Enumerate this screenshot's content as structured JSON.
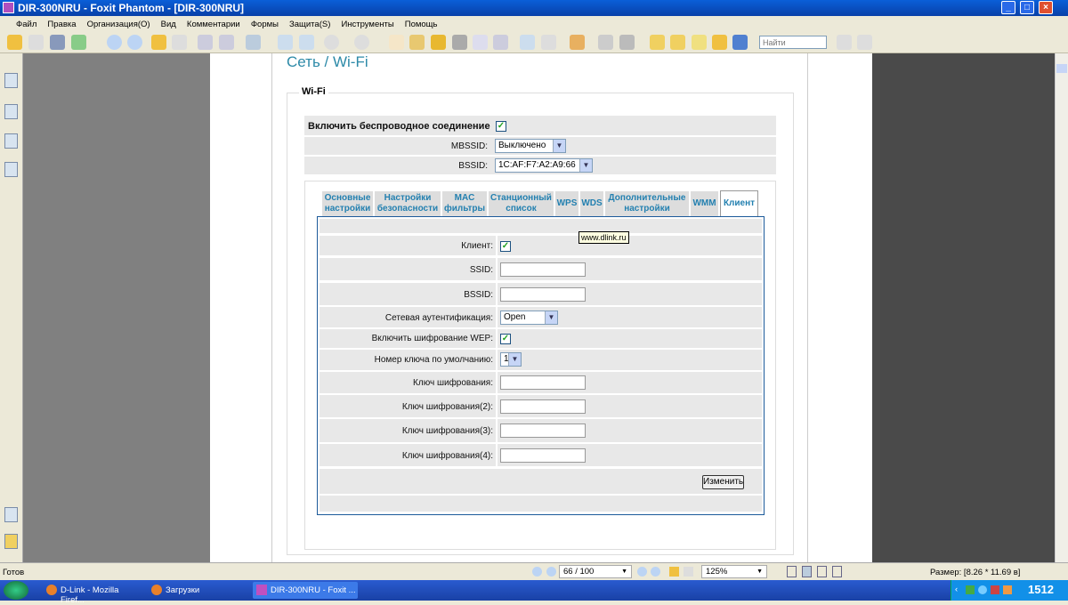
{
  "window": {
    "title": "DIR-300NRU - Foxit Phantom - [DIR-300NRU]"
  },
  "menu": [
    "Файл",
    "Правка",
    "Организация(O)",
    "Вид",
    "Комментарии",
    "Формы",
    "Защита(S)",
    "Инструменты",
    "Помощь"
  ],
  "toolbar": {
    "search_placeholder": "Найти"
  },
  "page": {
    "heading": "Сеть / Wi-Fi",
    "legend": "Wi-Fi",
    "enable_wireless_label": "Включить беспроводное соединение",
    "enable_wireless_checked": true,
    "mbssid_label": "MBSSID:",
    "mbssid_value": "Выключено",
    "bssid_label": "BSSID:",
    "bssid_value": "1C:AF:F7:A2:A9:66",
    "tabs": [
      {
        "line1": "Основные",
        "line2": "настройки"
      },
      {
        "line1": "Настройки",
        "line2": "безопасности"
      },
      {
        "line1": "MAC",
        "line2": "фильтры"
      },
      {
        "line1": "Станционный",
        "line2": "список"
      },
      {
        "line1": "WPS",
        "line2": ""
      },
      {
        "line1": "WDS",
        "line2": ""
      },
      {
        "line1": "Дополнительные",
        "line2": "настройки"
      },
      {
        "line1": "WMM",
        "line2": ""
      },
      {
        "line1": "Клиент",
        "line2": ""
      }
    ],
    "tooltip": "www.dlink.ru",
    "client": {
      "client_label": "Клиент:",
      "ssid_label": "SSID:",
      "ssid_value": "",
      "bssid_label": "BSSID:",
      "bssid_value": "",
      "auth_label": "Сетевая аутентификация:",
      "auth_value": "Open",
      "wep_label": "Включить шифрование WEP:",
      "default_key_label": "Номер ключа по умолчанию:",
      "default_key_value": "1",
      "key1_label": "Ключ шифрования:",
      "key2_label": "Ключ шифрования(2):",
      "key3_label": "Ключ шифрования(3):",
      "key4_label": "Ключ шифрования(4):",
      "change_button": "Изменить"
    }
  },
  "statusbar": {
    "status": "Готов",
    "page": "66 / 100",
    "zoom": "125%",
    "size": "Размер: [8.26 * 11.69 в]"
  },
  "taskbar": {
    "tasks": [
      "D-Link - Mozilla Firef...",
      "Загрузки",
      "DIR-300NRU - Foxit ..."
    ],
    "clock": "1512"
  }
}
